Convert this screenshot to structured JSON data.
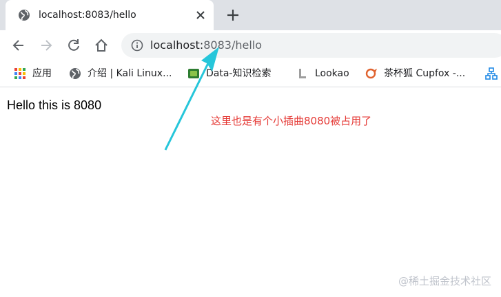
{
  "tab": {
    "title": "localhost:8083/hello"
  },
  "address_bar": {
    "url_host": "localhost:",
    "url_rest": "8083/hello"
  },
  "bookmarks": [
    {
      "label": "应用",
      "icon": "apps-grid-icon"
    },
    {
      "label": "介绍 | Kali Linux...",
      "icon": "globe-icon"
    },
    {
      "label": "Data-知识检索",
      "icon": "data-icon"
    },
    {
      "label": "Lookao",
      "icon": "lookao-icon"
    },
    {
      "label": "茶杯狐 Cupfox -...",
      "icon": "cupfox-icon"
    }
  ],
  "page": {
    "text": "Hello this is 8080"
  },
  "annotation": {
    "text": "这里也是有个小插曲8080被占用了"
  },
  "watermark": {
    "text": "@稀土掘金技术社区"
  },
  "colors": {
    "annotation": "#e53935",
    "arrow": "#26c6da",
    "tabstrip": "#dee1e6"
  }
}
